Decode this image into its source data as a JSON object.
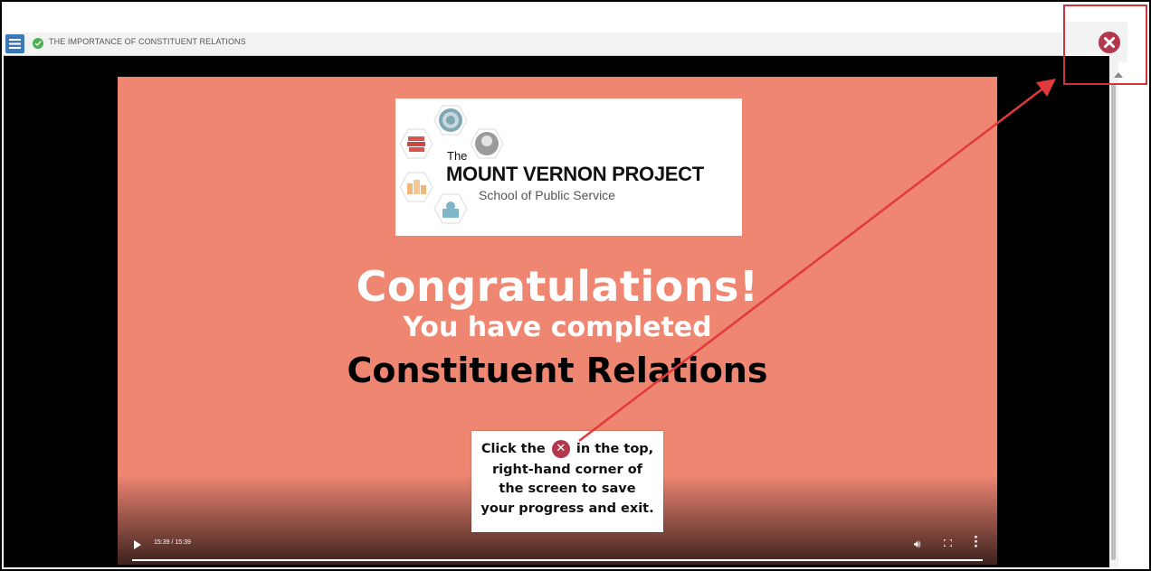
{
  "header": {
    "menu_icon": "hamburger-menu-icon",
    "status_icon": "check-circle-icon",
    "course_title": "THE IMPORTANCE OF CONSTITUENT RELATIONS"
  },
  "slide": {
    "logo": {
      "the": "The",
      "name": "MOUNT VERNON PROJECT",
      "subtitle": "School of Public Service"
    },
    "congrats": "Congratulations!",
    "completed": "You have completed",
    "course_name": "Constituent Relations",
    "instructions": {
      "line1_before": "Click the",
      "line1_after": "in the top,",
      "line2": "right-hand corner of",
      "line3": "the screen to save",
      "line4": "your progress and exit."
    }
  },
  "player": {
    "time": "15:39 / 15:39",
    "progress": 1.0,
    "icons": [
      "play-icon",
      "volume-icon",
      "fullscreen-icon",
      "more-options-icon"
    ]
  },
  "close": {
    "icon": "close-circle-icon",
    "color": "#b3384d"
  },
  "colors": {
    "slide_bg": "#ef8672",
    "highlight": "#d0333b",
    "menu_button": "#3c78b4"
  }
}
